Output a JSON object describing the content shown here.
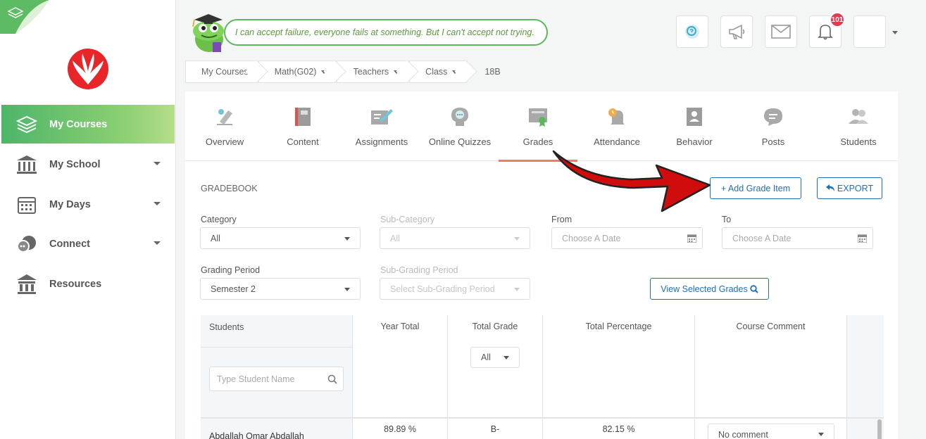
{
  "sidebar": {
    "items": [
      {
        "label": "My Courses",
        "icon": "layers-icon"
      },
      {
        "label": "My School",
        "icon": "school-icon"
      },
      {
        "label": "My Days",
        "icon": "calendar-icon"
      },
      {
        "label": "Connect",
        "icon": "chat-icon"
      },
      {
        "label": "Resources",
        "icon": "library-icon"
      }
    ]
  },
  "header": {
    "quote": "I can accept failure, everyone fails at something. But I can't accept not trying.",
    "notification_count": "101"
  },
  "breadcrumb": {
    "my_courses": "My Courses",
    "course": "Math(G02)",
    "teachers": "Teachers",
    "class": "Class",
    "section": "18B"
  },
  "tabs": [
    {
      "label": "Overview",
      "icon": "overview-icon"
    },
    {
      "label": "Content",
      "icon": "book-icon"
    },
    {
      "label": "Assignments",
      "icon": "assignment-icon"
    },
    {
      "label": "Online Quizzes",
      "icon": "quiz-icon"
    },
    {
      "label": "Grades",
      "icon": "certificate-icon"
    },
    {
      "label": "Attendance",
      "icon": "bell-clock-icon"
    },
    {
      "label": "Behavior",
      "icon": "id-card-icon"
    },
    {
      "label": "Posts",
      "icon": "speech-bubble-icon"
    },
    {
      "label": "Students",
      "icon": "people-icon"
    }
  ],
  "gradebook": {
    "title": "GRADEBOOK",
    "add_grade_item": "+ Add Grade Item",
    "export": "EXPORT",
    "view_selected": "View Selected Grades"
  },
  "filters": {
    "category_label": "Category",
    "category_value": "All",
    "subcategory_label": "Sub-Category",
    "subcategory_value": "All",
    "from_label": "From",
    "from_placeholder": "Choose A Date",
    "to_label": "To",
    "to_placeholder": "Choose A Date",
    "grading_period_label": "Grading Period",
    "grading_period_value": "Semester 2",
    "subgrading_label": "Sub-Grading Period",
    "subgrading_placeholder": "Select Sub-Grading Period"
  },
  "table": {
    "headers": {
      "students": "Students",
      "year_total": "Year Total",
      "total_grade": "Total Grade",
      "total_percentage": "Total Percentage",
      "course_comment": "Course Comment"
    },
    "student_search_placeholder": "Type Student Name",
    "grade_filter": "All",
    "rows": [
      {
        "name": "Abdallah Omar Abdallah",
        "year_total": "89.89 %",
        "grade": "B-",
        "percentage": "82.15 %",
        "comment": "No comment"
      }
    ]
  },
  "colors": {
    "sidebar_active": "#4db56a",
    "accent_blue": "#1d70b7",
    "tab_underline": "#ef7f5c",
    "badge": "#e8384f",
    "arrow": "#d10c0c"
  }
}
